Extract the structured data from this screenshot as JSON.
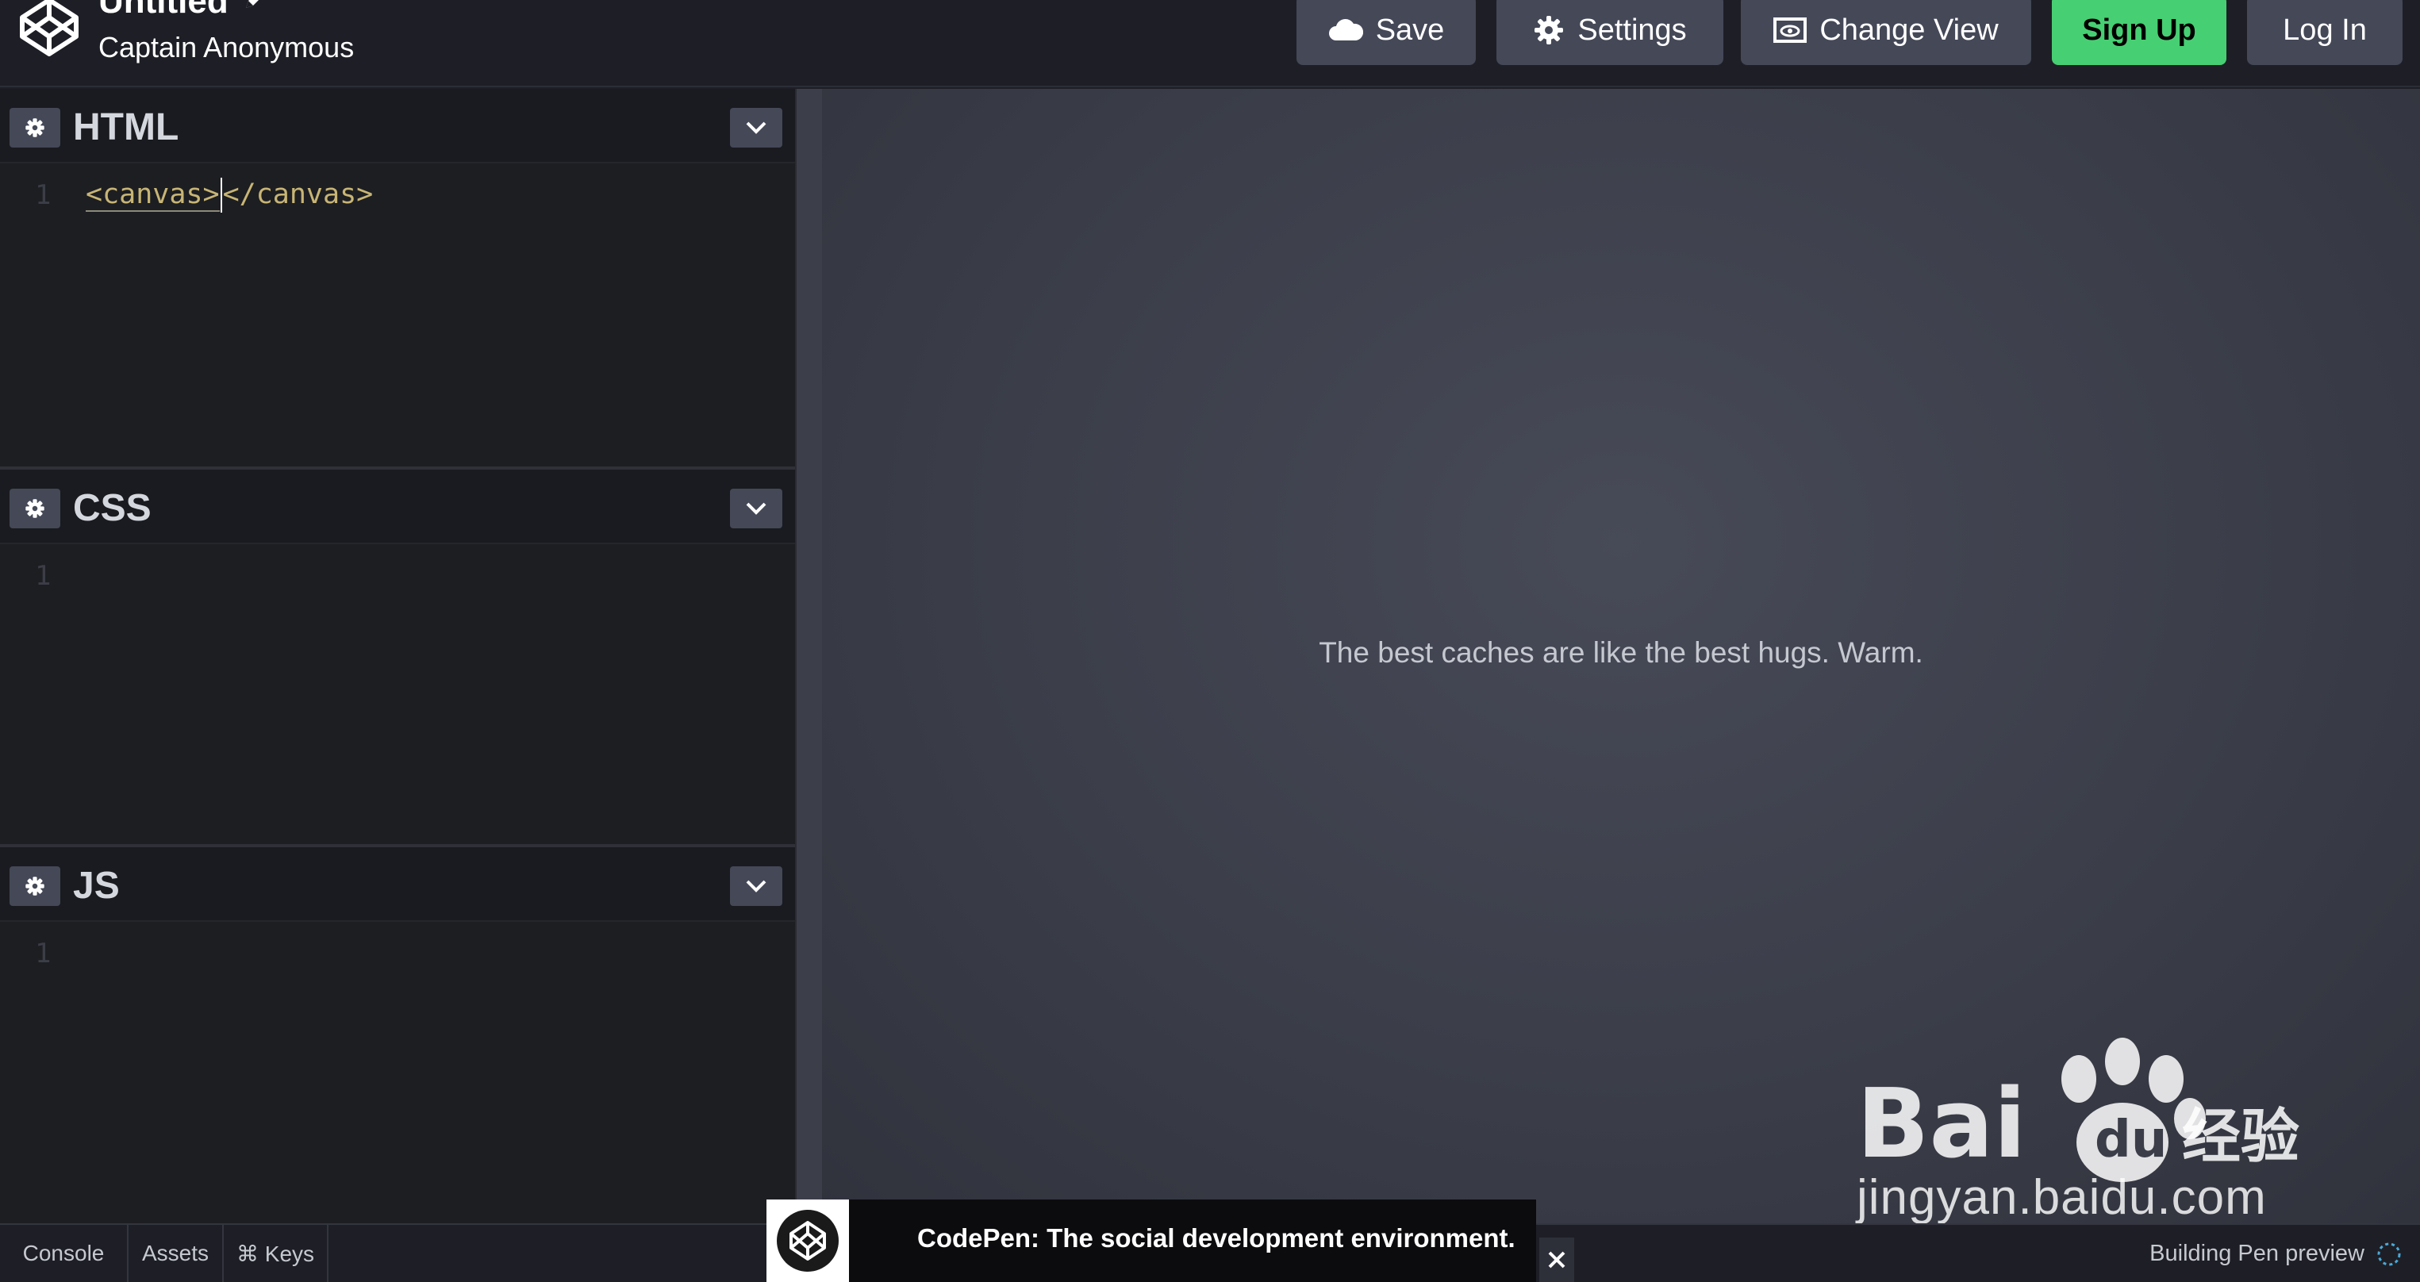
{
  "header": {
    "title": "Untitled",
    "author": "Captain Anonymous",
    "buttons": {
      "save": "Save",
      "settings": "Settings",
      "change_view": "Change View",
      "sign_up": "Sign Up",
      "log_in": "Log In"
    },
    "accent_color": "#47cf73"
  },
  "editors": [
    {
      "lang": "HTML",
      "line_number": "1",
      "code_open": "<canvas>",
      "code_close": "</canvas>"
    },
    {
      "lang": "CSS",
      "line_number": "1"
    },
    {
      "lang": "JS",
      "line_number": "1"
    }
  ],
  "preview": {
    "message": "The best caches are like the best hugs. Warm."
  },
  "footer": {
    "console": "Console",
    "assets": "Assets",
    "keys": "⌘ Keys",
    "status": "Building Pen preview"
  },
  "toast": {
    "text": "CodePen: The social development environment."
  },
  "watermark": {
    "brand": "Bai du 经验",
    "site": "jingyan.baidu.com"
  }
}
